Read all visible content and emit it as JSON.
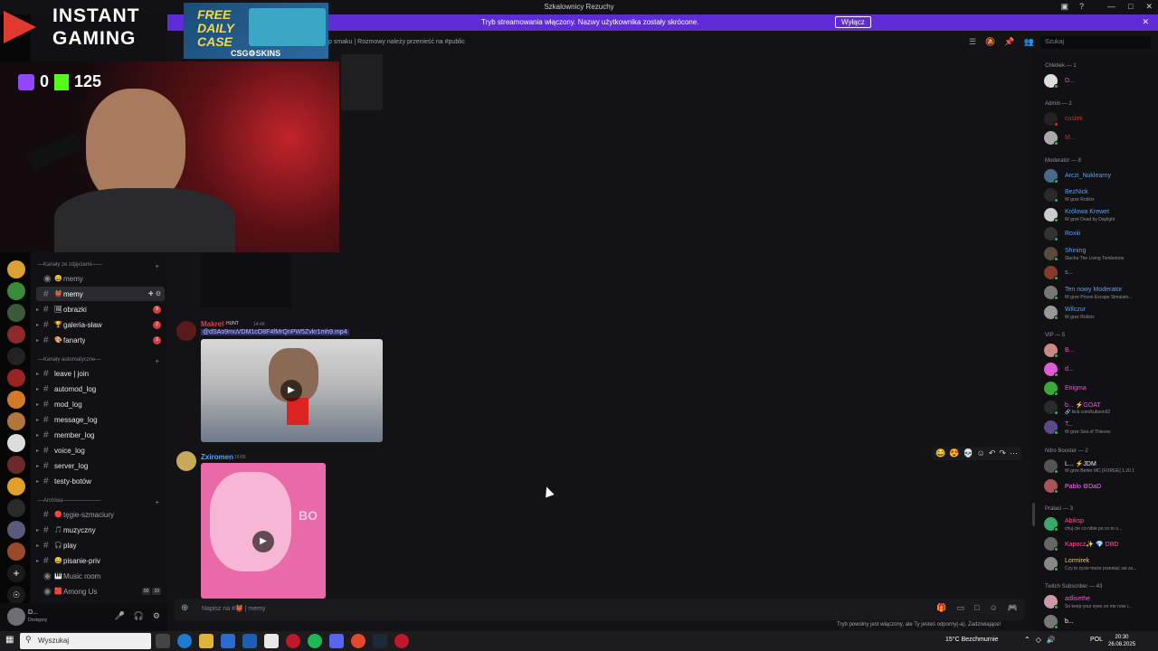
{
  "window": {
    "title": "Szkalownicy Rezuchy"
  },
  "banner": {
    "text": "Tryb streamowania włączony. Nazwy użytkownika zostały skrócone.",
    "button": "Wyłącz"
  },
  "overlay": {
    "brand_line1": "INSTANT",
    "brand_line2": "GAMING",
    "ad_title": "FREE DAILY CASE",
    "ad_brand": "CSG⚙SKINS",
    "twitch_count": "0",
    "kick_count": "125"
  },
  "header": {
    "topic": "p smaku | Rozmowy należy przenieść na #public",
    "search_placeholder": "Szukaj"
  },
  "sidebar": {
    "categories": [
      {
        "label": "—Kanały ze zdjęciami——"
      },
      {
        "label": "—Kanały automatyczne—"
      },
      {
        "label": "—Archiwa———————"
      }
    ],
    "channels": [
      {
        "label": "memy",
        "emoji": "😀"
      },
      {
        "label": "memy",
        "emoji": "👹"
      },
      {
        "label": "obrazki",
        "emoji": "🖼",
        "badge": "9"
      },
      {
        "label": "galeria-sław",
        "emoji": "🏆",
        "badge": "2"
      },
      {
        "label": "fanarty",
        "emoji": "🎨",
        "badge": "3"
      },
      {
        "label": "leave | join"
      },
      {
        "label": "automod_log"
      },
      {
        "label": "mod_log"
      },
      {
        "label": "message_log"
      },
      {
        "label": "member_log"
      },
      {
        "label": "voice_log"
      },
      {
        "label": "server_log"
      },
      {
        "label": "testy-botów"
      },
      {
        "label": "tęgie-szmaciury",
        "emoji": "🔴"
      },
      {
        "label": "muzyczny",
        "emoji": "🎵"
      },
      {
        "label": "play",
        "emoji": "🎧"
      },
      {
        "label": "pisanie-priv",
        "emoji": "😄"
      },
      {
        "label": "Music room",
        "emoji": "🎹"
      },
      {
        "label": "Among Us",
        "emoji": "🟥",
        "count_a": "00",
        "count_b": "10"
      }
    ]
  },
  "messages": [
    {
      "author": "Makrel",
      "role": "HUNT",
      "time": "14:49",
      "attachment": "@dSAo9muVDM1cO8F4fMrQnPW5Zvkr1mh9.mp4"
    },
    {
      "author": "Zxiromen",
      "time": "16:65"
    }
  ],
  "composer": {
    "placeholder": "Napisz na #👹 | memy",
    "slowmode": "Tryb powolny jest włączony, ale Ty jesteś odporny(-a). Zadziwiające!"
  },
  "members": {
    "groups": [
      {
        "label": "Chlebek — 1"
      },
      {
        "label": "Admin — 2"
      },
      {
        "label": "Moderator — 8"
      },
      {
        "label": "VIP — 5"
      },
      {
        "label": "Nitro Booster — 2"
      },
      {
        "label": "Pralaci — 3"
      },
      {
        "label": "Twitch Subscriber — 43"
      }
    ],
    "list": [
      {
        "name": "D...",
        "color": "#e05cd6"
      },
      {
        "name": "cuslek",
        "color": "#c0392b"
      },
      {
        "name": "M...",
        "color": "#c0392b"
      },
      {
        "name": "Arczi_Nuklearny",
        "color": "#5aa0ea"
      },
      {
        "name": "BezNick",
        "color": "#5aa0ea",
        "activity": "W grze Roblox"
      },
      {
        "name": "Królowa Krewet",
        "color": "#5aa0ea",
        "activity": "W grze Dead by Daylight"
      },
      {
        "name": "Roxiii",
        "color": "#5aa0ea"
      },
      {
        "name": "Shining",
        "color": "#5aa0ea",
        "activity": "Słucha The Living Tombstone"
      },
      {
        "name": "s...",
        "color": "#5aa0ea"
      },
      {
        "name": "Ten nowy Moderator",
        "color": "#5aa0ea",
        "activity": "W grze Prison Escape Simulato..."
      },
      {
        "name": "Wilczur",
        "color": "#5aa0ea",
        "activity": "W grze Roblox"
      },
      {
        "name": "B...",
        "color": "#e05cd6"
      },
      {
        "name": "d...",
        "color": "#e05cd6"
      },
      {
        "name": "Enigma",
        "color": "#e05cd6"
      },
      {
        "name": "b... ⚡GOAT",
        "color": "#e05cd6",
        "activity": "🔗 kick.com/kubson92"
      },
      {
        "name": "T...",
        "color": "#e05cd6",
        "activity": "W grze Sea of Thieves"
      },
      {
        "name": "L... ⚡JDM",
        "color": "#f0f0f0",
        "activity": "W grze Better MC [FORGE] 1.20.1"
      },
      {
        "name": "Pablo ⚙DaD",
        "color": "#ff73fa"
      },
      {
        "name": "Abiksp",
        "color": "#ff4f9a",
        "activity": "chuj cie co nible po co to o..."
      },
      {
        "name": "Kapocz✨ 💎 DBD",
        "color": "#ff4f9a"
      },
      {
        "name": "Lormirek",
        "color": "#f2c94c",
        "activity": "Czy te życie może przestać sie ze..."
      },
      {
        "name": "adlisethe",
        "color": "#e05cd6",
        "activity": "So keep your eyes on me now i..."
      },
      {
        "name": "b...",
        "color": "#f0f0f0"
      }
    ]
  },
  "taskbar": {
    "search": "Wyszukaj",
    "weather": "15°C  Bezchmurnie",
    "lang": "POL",
    "time": "20:30",
    "date": "26.08.2025"
  },
  "colors": {
    "accent": "#5e2bd6",
    "brand_red": "#e23a2f"
  }
}
